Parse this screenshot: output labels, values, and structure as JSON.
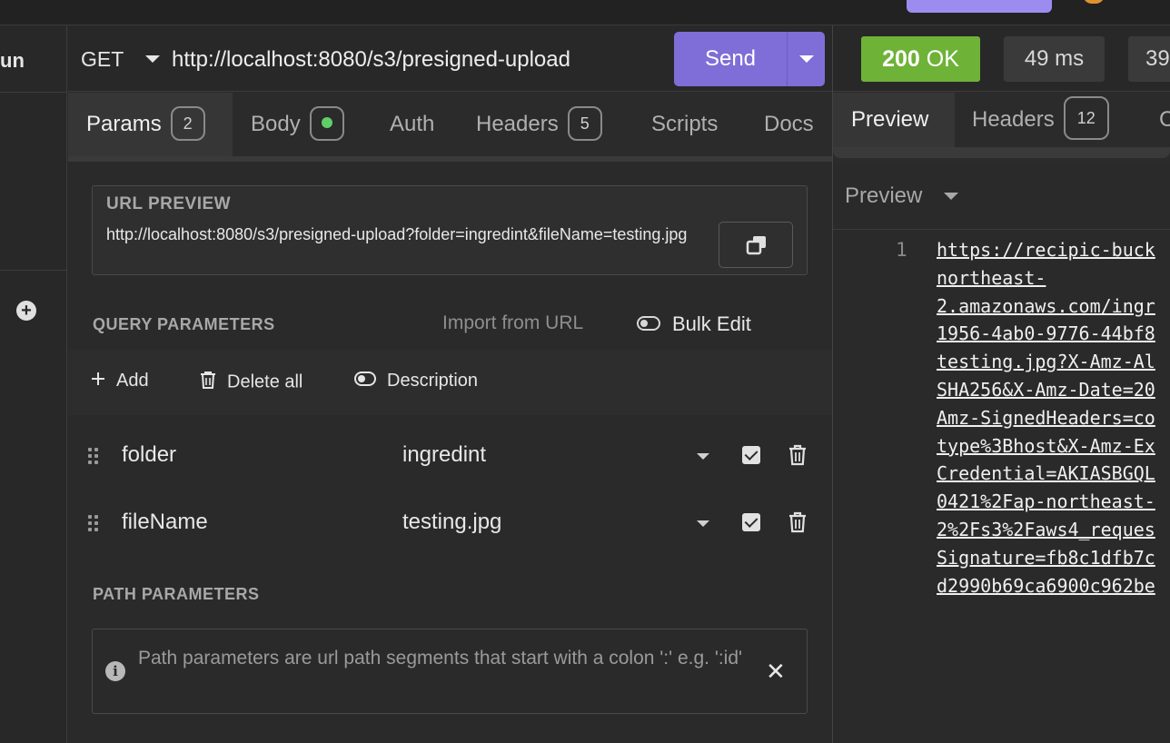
{
  "sidebar": {
    "run_label": "un"
  },
  "request": {
    "method": "GET",
    "url": "http://localhost:8080/s3/presigned-upload",
    "send_label": "Send"
  },
  "tabs": [
    {
      "label": "Params",
      "badge": "2"
    },
    {
      "label": "Body"
    },
    {
      "label": "Auth"
    },
    {
      "label": "Headers",
      "badge": "5"
    },
    {
      "label": "Scripts"
    },
    {
      "label": "Docs"
    }
  ],
  "url_preview": {
    "title": "URL PREVIEW",
    "text": "http://localhost:8080/s3/presigned-upload?folder=ingredint&fileName=testing.jpg"
  },
  "query": {
    "title": "QUERY PARAMETERS",
    "import_label": "Import from URL",
    "bulk_edit_label": "Bulk Edit",
    "add_label": "Add",
    "delete_all_label": "Delete all",
    "description_label": "Description",
    "params": [
      {
        "key": "folder",
        "value": "ingredint",
        "enabled": true
      },
      {
        "key": "fileName",
        "value": "testing.jpg",
        "enabled": true
      }
    ]
  },
  "path": {
    "title": "PATH PARAMETERS",
    "info": "Path parameters are url path segments that start with a colon ':' e.g. ':id'"
  },
  "response": {
    "status_code": "200",
    "status_text": "OK",
    "time": "49 ms",
    "size": "39",
    "tabs": [
      {
        "label": "Preview"
      },
      {
        "label": "Headers",
        "badge": "12"
      },
      {
        "label": "C"
      }
    ],
    "preview_mode": "Preview",
    "line_number": "1",
    "body_lines": [
      "https://recipic-buck",
      "northeast-",
      "2.amazonaws.com/ingr",
      "1956-4ab0-9776-44bf8",
      "testing.jpg?X-Amz-Al",
      "SHA256&X-Amz-Date=20",
      "Amz-SignedHeaders=co",
      "type%3Bhost&X-Amz-Ex",
      "Credential=AKIASBGQL",
      "0421%2Fap-northeast-",
      "2%2Fs3%2Faws4_reques",
      "Signature=fb8c1dfb7c",
      "d2990b69ca6900c962be"
    ]
  },
  "colors": {
    "accent": "#7f6ed7",
    "status_ok": "#6fb238",
    "enabled_dot": "#5fcf68"
  }
}
